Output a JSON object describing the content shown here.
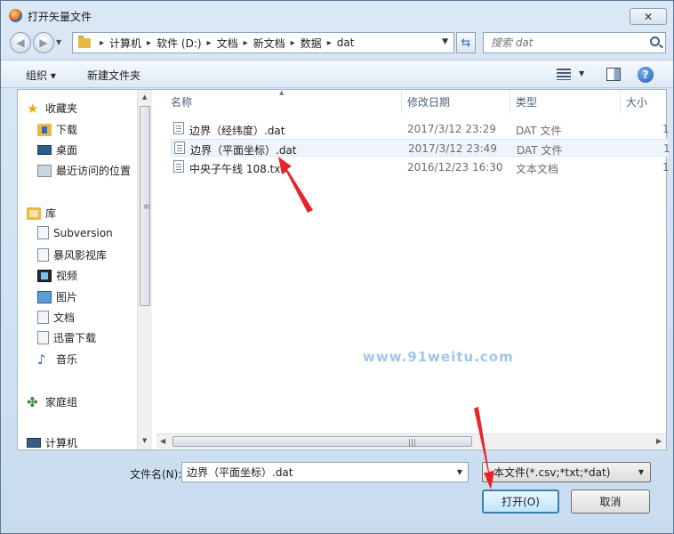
{
  "window": {
    "title": "打开矢量文件",
    "close_glyph": "✕"
  },
  "nav": {
    "back_glyph": "◀",
    "forward_glyph": "▶",
    "breadcrumbs": [
      "计算机",
      "软件 (D:)",
      "文档",
      "新文档",
      "数据",
      "dat"
    ],
    "refresh_glyph": "⇆",
    "search_placeholder": "搜索 dat"
  },
  "toolbar": {
    "organize": "组织 ▾",
    "new_folder": "新建文件夹",
    "help_glyph": "?"
  },
  "sidebar": {
    "favorites": {
      "label": "收藏夹",
      "items": [
        "下载",
        "桌面",
        "最近访问的位置"
      ]
    },
    "libraries": {
      "label": "库",
      "items": [
        "Subversion",
        "暴风影视库",
        "视频",
        "图片",
        "文档",
        "迅雷下载",
        "音乐"
      ]
    },
    "homegroup": "家庭组",
    "computer": "计算机"
  },
  "columns": {
    "name": "名称",
    "modified": "修改日期",
    "type": "类型",
    "size": "大小"
  },
  "files": [
    {
      "name": "边界（经纬度）.dat",
      "modified": "2017/3/12 23:29",
      "type": "DAT 文件",
      "size": "1"
    },
    {
      "name": "边界（平面坐标）.dat",
      "modified": "2017/3/12 23:49",
      "type": "DAT 文件",
      "size": "1"
    },
    {
      "name": "中央子午线 108.txt",
      "modified": "2016/12/23 16:30",
      "type": "文本文档",
      "size": "1"
    }
  ],
  "watermark": "www.91weitu.com",
  "bottom": {
    "filename_label": "文件名(N):",
    "filename_value": "边界（平面坐标）.dat",
    "filetype_value": "本文件(*.csv;*txt;*dat)",
    "open_button": "打开(O)",
    "cancel_button": "取消"
  },
  "colors": {
    "annotation_arrow": "#e8242b",
    "selection": "#eef4fb"
  }
}
